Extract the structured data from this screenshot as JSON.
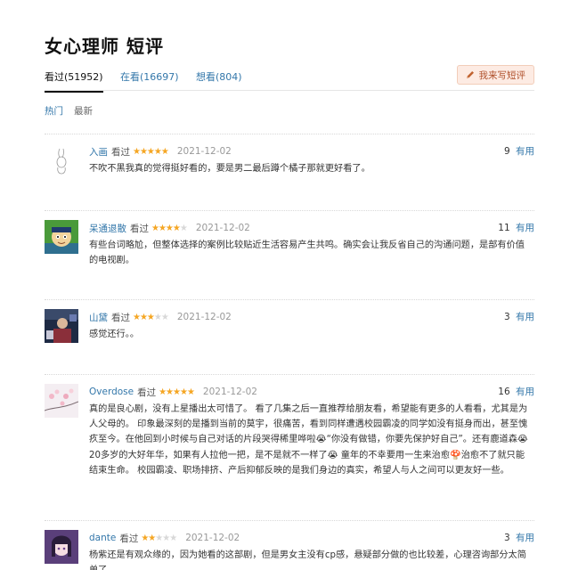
{
  "page": {
    "title": "女心理师 短评"
  },
  "tabs": [
    {
      "label": "看过(51952)",
      "active": true
    },
    {
      "label": "在看(16697)",
      "active": false
    },
    {
      "label": "想看(804)",
      "active": false
    }
  ],
  "write_button": {
    "label": "我来写短评",
    "icon": "pencil-icon"
  },
  "filters": [
    {
      "label": "热门"
    },
    {
      "label": "最新"
    }
  ],
  "comments": [
    {
      "user": "入画",
      "status": "看过",
      "rating": 5,
      "date": "2021-12-02",
      "votes": "9",
      "useful_label": "有用",
      "text": "不吹不黑我真的觉得挺好看的，要是男二最后蹲个橘子那就更好看了。"
    },
    {
      "user": "呆通退散",
      "status": "看过",
      "rating": 4,
      "date": "2021-12-02",
      "votes": "11",
      "useful_label": "有用",
      "text": "有些台词略尬，但整体选择的案例比较贴近生活容易产生共鸣。确实会让我反省自己的沟通问题，是部有价值的电视剧。"
    },
    {
      "user": "山黛",
      "status": "看过",
      "rating": 3,
      "date": "2021-12-02",
      "votes": "3",
      "useful_label": "有用",
      "text": "感觉还行。。"
    },
    {
      "user": "Overdose",
      "status": "看过",
      "rating": 5,
      "date": "2021-12-02",
      "votes": "16",
      "useful_label": "有用",
      "text": "真的是良心剧，没有上星播出太可惜了。 看了几集之后一直推荐给朋友看，希望能有更多的人看看，尤其是为人父母的。 印象最深刻的是播到当前的莫宇，很痛苦，看到同样遭遇校园霸凌的同学如没有挺身而出，甚至愧疚至今。在他回到小时候与自己对话的片段哭得稀里哗啦😭“你没有做错，你要先保护好自己”。还有鹿道森😭20多岁的大好年华，如果有人拉他一把，是不是就不一样了😭 童年的不幸要用一生来治愈🍄治愈不了就只能结束生命。 校园霸凌、职场排挤、产后抑郁反映的是我们身边的真实，希望人与人之间可以更友好一些。"
    },
    {
      "user": "dante",
      "status": "看过",
      "rating": 2,
      "date": "2021-12-02",
      "votes": "3",
      "useful_label": "有用",
      "text": "杨紫还是有观众缘的，因为她看的这部剧，但是男女主没有cp感，悬疑部分做的也比较差，心理咨询部分太简单了。"
    }
  ]
}
